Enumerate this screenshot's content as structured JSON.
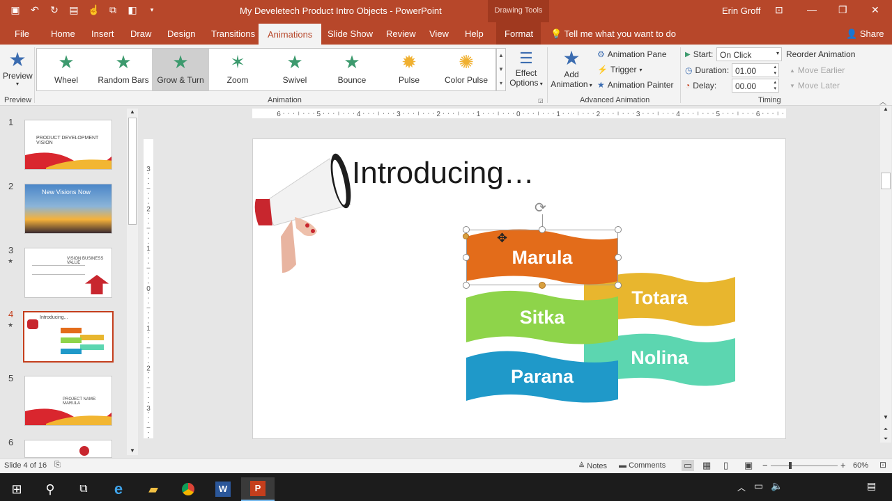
{
  "titlebar": {
    "document_title": "My Develetech Product Intro Objects - PowerPoint",
    "context_label": "Drawing Tools",
    "user_name": "Erin Groff"
  },
  "tabs": [
    {
      "label": "File"
    },
    {
      "label": "Home"
    },
    {
      "label": "Insert"
    },
    {
      "label": "Draw"
    },
    {
      "label": "Design"
    },
    {
      "label": "Transitions"
    },
    {
      "label": "Animations"
    },
    {
      "label": "Slide Show"
    },
    {
      "label": "Review"
    },
    {
      "label": "View"
    },
    {
      "label": "Help"
    },
    {
      "label": "Format"
    }
  ],
  "active_tab": "Animations",
  "tell_me": "Tell me what you want to do",
  "share_label": "Share",
  "ribbon": {
    "preview": {
      "label": "Preview",
      "group": "Preview"
    },
    "animation_group_label": "Animation",
    "gallery": [
      {
        "label": "Wheel",
        "color": "#3d9a6e"
      },
      {
        "label": "Random Bars",
        "color": "#3d9a6e"
      },
      {
        "label": "Grow & Turn",
        "color": "#3d9a6e"
      },
      {
        "label": "Zoom",
        "color": "#3d9a6e"
      },
      {
        "label": "Swivel",
        "color": "#3d9a6e"
      },
      {
        "label": "Bounce",
        "color": "#3d9a6e"
      },
      {
        "label": "Pulse",
        "color": "#f0b030"
      },
      {
        "label": "Color Pulse",
        "color": "#f0b030"
      }
    ],
    "selected_effect": "Grow & Turn",
    "effect_options": {
      "line1": "Effect",
      "line2": "Options"
    },
    "advanced": {
      "group_label": "Advanced Animation",
      "add_animation_line1": "Add",
      "add_animation_line2": "Animation",
      "animation_pane": "Animation Pane",
      "trigger": "Trigger",
      "animation_painter": "Animation Painter"
    },
    "timing": {
      "group_label": "Timing",
      "start_label": "Start:",
      "start_value": "On Click",
      "duration_label": "Duration:",
      "duration_value": "01.00",
      "delay_label": "Delay:",
      "delay_value": "00.00",
      "reorder_label": "Reorder Animation",
      "move_earlier": "Move Earlier",
      "move_later": "Move Later"
    }
  },
  "thumbnails": [
    {
      "num": "1",
      "text": "PRODUCT DEVELOPMENT VISION",
      "starred": false
    },
    {
      "num": "2",
      "text": "New Visions Now",
      "starred": false
    },
    {
      "num": "3",
      "text": "VISION BUSINESS VALUE",
      "starred": true
    },
    {
      "num": "4",
      "text": "Introducing...",
      "starred": true
    },
    {
      "num": "5",
      "text": "PROJECT NAME: MARULA",
      "starred": false
    },
    {
      "num": "6",
      "text": "",
      "starred": false
    }
  ],
  "ruler_h_labels": [
    "6",
    "5",
    "4",
    "3",
    "2",
    "1",
    "0",
    "1",
    "2",
    "3",
    "4",
    "5",
    "6"
  ],
  "ruler_v_labels": [
    "3",
    "2",
    "1",
    "0",
    "1",
    "2",
    "3"
  ],
  "slide": {
    "title": "Introducing…",
    "banners": [
      {
        "label": "Marula",
        "color": "#e36c1a"
      },
      {
        "label": "Totara",
        "color": "#e8b62e"
      },
      {
        "label": "Sitka",
        "color": "#8ed44a"
      },
      {
        "label": "Nolina",
        "color": "#5cd6b0"
      },
      {
        "label": "Parana",
        "color": "#1f99c9"
      }
    ]
  },
  "status": {
    "slide_info": "Slide 4 of 16",
    "notes": "Notes",
    "comments": "Comments",
    "zoom": "60%"
  }
}
